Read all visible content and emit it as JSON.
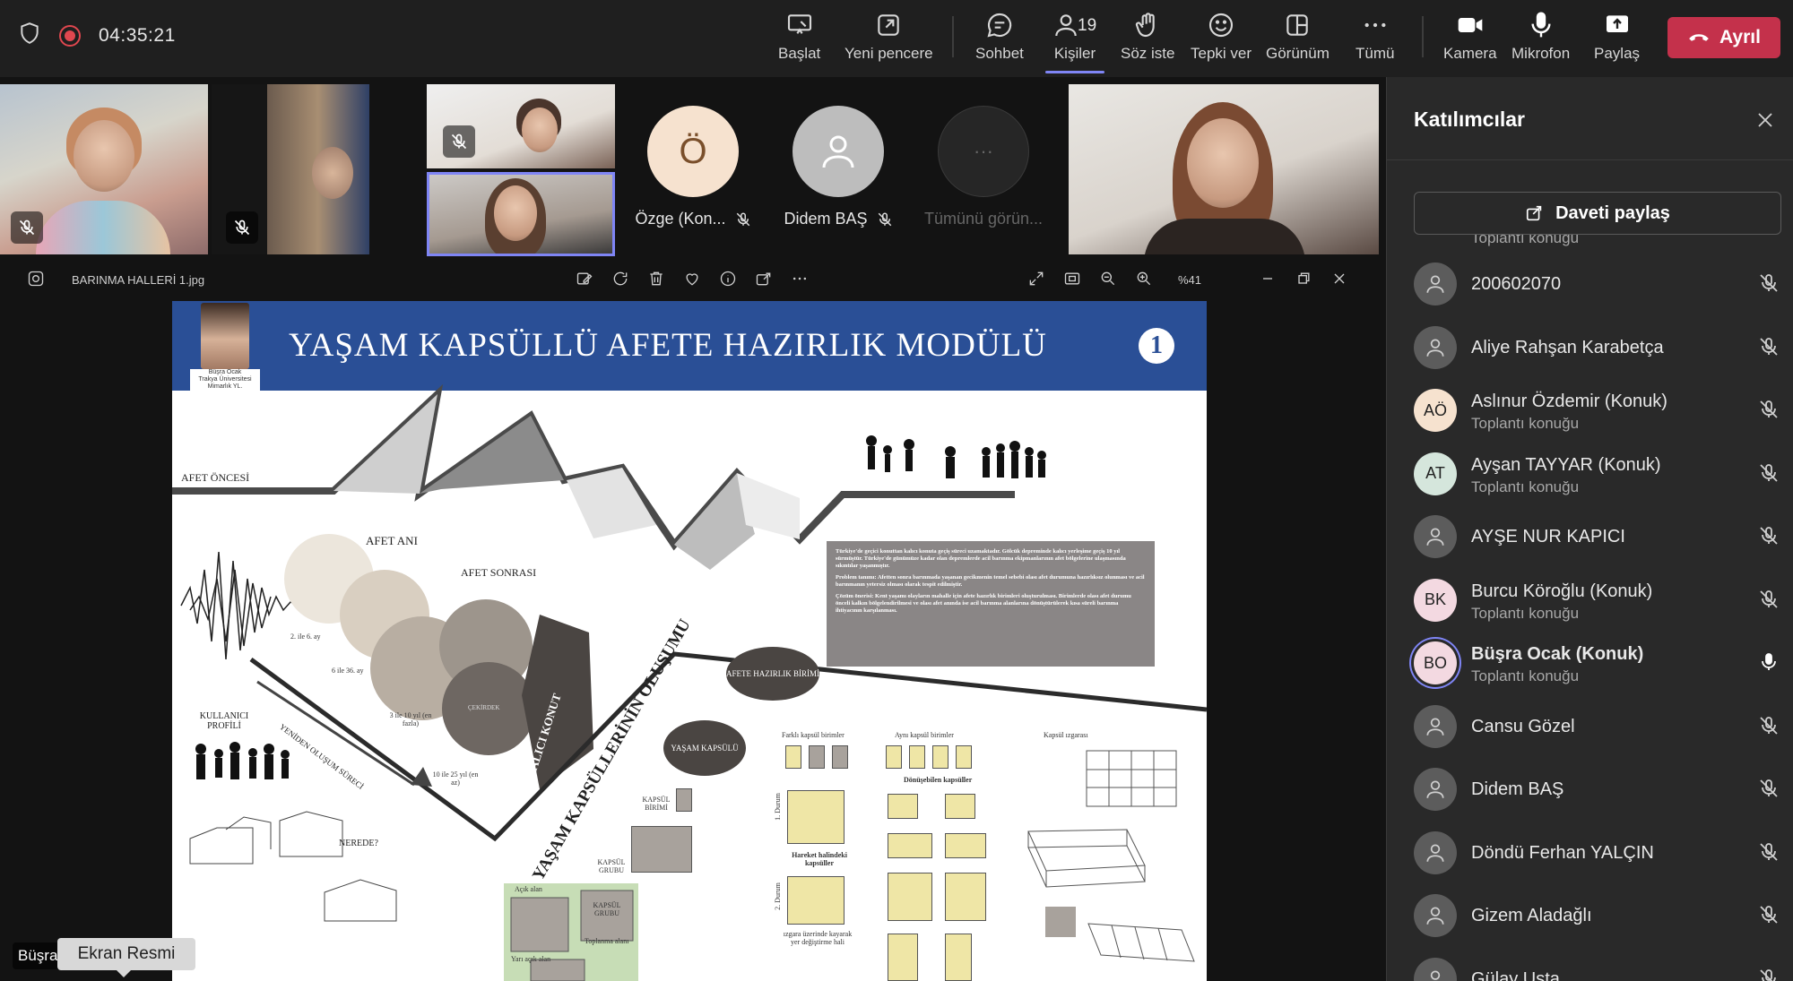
{
  "toolbar": {
    "timer": "04:35:21",
    "buttons": {
      "start": "Başlat",
      "new_window": "Yeni pencere",
      "chat": "Sohbet",
      "people": "Kişiler",
      "people_count": "19",
      "raise_hand": "Söz iste",
      "react": "Tepki ver",
      "view": "Görünüm",
      "more": "Tümü",
      "camera": "Kamera",
      "mic": "Mikrofon",
      "share": "Paylaş"
    },
    "leave": "Ayrıl",
    "accent_color": "#7f85f5",
    "leave_color": "#c4314b"
  },
  "gallery": {
    "avatars": [
      {
        "initial": "Ö",
        "label": "Özge (Kon...",
        "color": "#f6e2cf"
      },
      {
        "initial": "",
        "label": "Didem BAŞ",
        "color": "#bdbdbd"
      },
      {
        "initial": "···",
        "label": "Tümünü görün...",
        "color": "#262626"
      }
    ]
  },
  "viewer": {
    "filename": "BARINMA HALLERİ 1.jpg",
    "zoom": "%41"
  },
  "poster": {
    "title": "YAŞAM KAPSÜLLÜ AFETE HAZIRLIK MODÜLÜ",
    "number": "1",
    "author": "Büşra Ocak\nTrakya Üniversitesi\nMimarlık YL.",
    "labels": {
      "before": "AFET ÖNCESİ",
      "during": "AFET ANI",
      "after": "AFET SONRASI",
      "user_profile": "KULLANICI PROFİLİ",
      "where": "NEREDE?",
      "reformation": "YENİDEN OLUŞUM SÜRECİ",
      "permanent": "KALICI KONUT",
      "formation": "YAŞAM KAPSÜLLERİNİN OLUŞUMU",
      "unit": "AFETE HAZIRLIK BİRİMİ",
      "capsule": "YAŞAM KAPSÜLÜ",
      "core": "ÇEKİRDEK",
      "capsule_unit": "KAPSÜL BİRİMİ",
      "capsule_group": "KAPSÜL GRUBU",
      "open_area": "Açık alan",
      "semi_open": "Yarı açık alan",
      "gathering": "Toplanma alanı",
      "different_units": "Farklı kapsül birimler",
      "same_units": "Aynı kapsül birimler",
      "capsule_grid": "Kapsül ızgarası",
      "convertible": "Dönüşebilen kapsüller",
      "moving": "Hareket halindeki kapsüller",
      "grid_shift": "ızgara üzerinde kayarak yer değiştirme hali",
      "status1": "1. Durum",
      "status2": "2. Durum",
      "t1": "2. ile 6. ay",
      "t2": "6 ile 36. ay",
      "t3": "3 ile 10 yıl (en fazla)",
      "t4": "10 ile 25 yıl (en az)"
    },
    "info_paragraphs": [
      "Türkiye'de geçici konuttan kalıcı konuta geçiş süreci uzamaktadır. Gölcük depreminde kalıcı yerleşime geçiş 10 yıl sürmüştür. Türkiye'de günümüze kadar olan depremlerde acil barınma ekipmanlarının afet bölgelerine ulaşmasında sıkıntılar yaşanmıştır.",
      "Problem tanımı: Afetten sonra barınmada yaşanan gecikmenin temel sebebi olası afet durumuna hazırlıksız olunması ve acil barınmanın yetersiz olması olarak tespit edilmiştir.",
      "Çözüm önerisi: Kent yaşamı olayların mahalle için afete hazırlık birimleri oluşturulması. Birimlerde olası afet durumu önceli kalkın bölgelendirilmesi ve olası afet anında ise acil barınma alanlarına dönüştürülerek kısa süreli barınma ihtiyacının karşılanması."
    ]
  },
  "participants": {
    "title": "Katılımcılar",
    "invite": "Daveti paylaş",
    "partial_top": "Toplantı konuğu",
    "list": [
      {
        "name": "200602070",
        "sub": "",
        "initials": "",
        "avatar_color": "#5c5c5c",
        "mic": "muted"
      },
      {
        "name": "Aliye Rahşan Karabetça",
        "sub": "",
        "initials": "",
        "avatar_color": "#5c5c5c",
        "mic": "muted"
      },
      {
        "name": "Aslınur Özdemir (Konuk)",
        "sub": "Toplantı konuğu",
        "initials": "AÖ",
        "avatar_color": "#f6e2cf",
        "mic": "muted"
      },
      {
        "name": "Ayşan TAYYAR (Konuk)",
        "sub": "Toplantı konuğu",
        "initials": "AT",
        "avatar_color": "#d5e6dc",
        "mic": "muted"
      },
      {
        "name": "AYŞE NUR KAPICI",
        "sub": "",
        "initials": "",
        "avatar_color": "#5c5c5c",
        "mic": "muted"
      },
      {
        "name": "Burcu Köroğlu (Konuk)",
        "sub": "Toplantı konuğu",
        "initials": "BK",
        "avatar_color": "#f3d9e1",
        "mic": "muted"
      },
      {
        "name": "Büşra Ocak (Konuk)",
        "sub": "Toplantı konuğu",
        "initials": "BO",
        "avatar_color": "#f3d9e1",
        "mic": "on"
      },
      {
        "name": "Cansu Gözel",
        "sub": "",
        "initials": "",
        "avatar_color": "#5c5c5c",
        "mic": "muted"
      },
      {
        "name": "Didem BAŞ",
        "sub": "",
        "initials": "",
        "avatar_color": "#5c5c5c",
        "mic": "muted"
      },
      {
        "name": "Döndü Ferhan YALÇIN",
        "sub": "",
        "initials": "",
        "avatar_color": "#5c5c5c",
        "mic": "muted"
      },
      {
        "name": "Gizem Aladağlı",
        "sub": "",
        "initials": "",
        "avatar_color": "#5c5c5c",
        "mic": "muted"
      },
      {
        "name": "Gülay Usta",
        "sub": "",
        "initials": "",
        "avatar_color": "#5c5c5c",
        "mic": "muted"
      }
    ]
  },
  "tooltip": "Ekran Resmi",
  "name_chip": "Büşra"
}
